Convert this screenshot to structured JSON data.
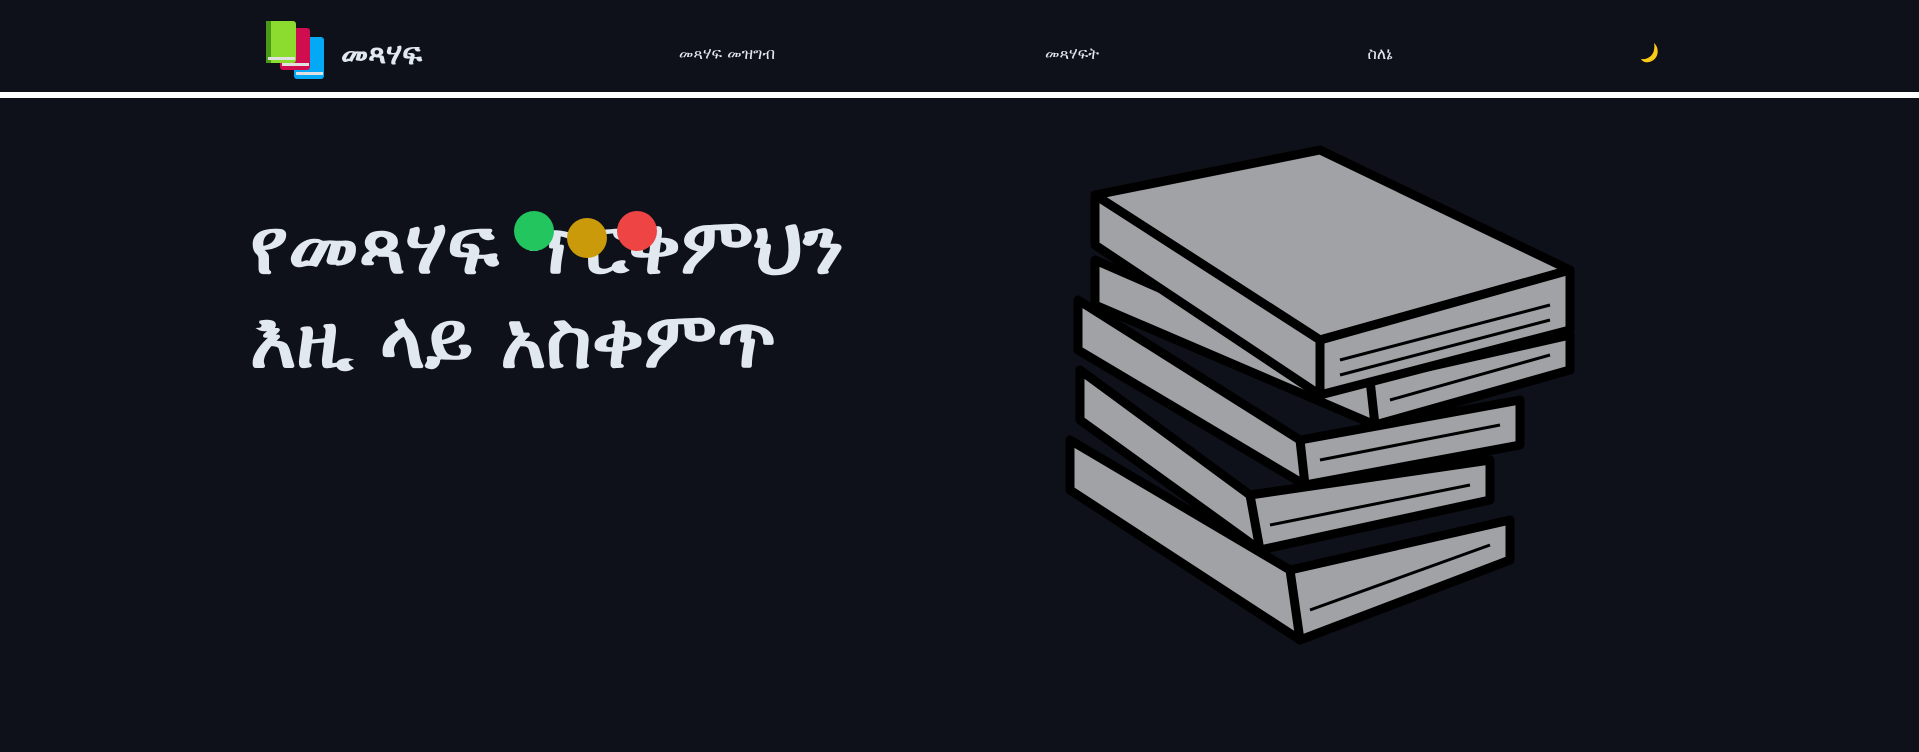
{
  "header": {
    "logo": {
      "text": "መጻሃፍ",
      "icon": "books-icon"
    },
    "nav": [
      {
        "label": "መጻሃፍ መዝግብ"
      },
      {
        "label": "መጻሃፍት"
      },
      {
        "label": "ስለኔ"
      }
    ],
    "theme_toggle": {
      "icon": "moon-icon",
      "color": "#facc15"
    }
  },
  "hero": {
    "title": "የመጻሃፍ ጥርቅምህን እዚ ላይ አስቀምጥ",
    "dots": [
      {
        "color": "#22c55e"
      },
      {
        "color": "#ca9a0b"
      },
      {
        "color": "#ef4444"
      }
    ],
    "illustration": {
      "icon": "book-stack-illustration",
      "fill": "#a1a2a6",
      "outline": "#000000"
    }
  },
  "colors": {
    "background": "#0e1119",
    "text": "#e2e8f0",
    "divider": "#ffffff"
  }
}
